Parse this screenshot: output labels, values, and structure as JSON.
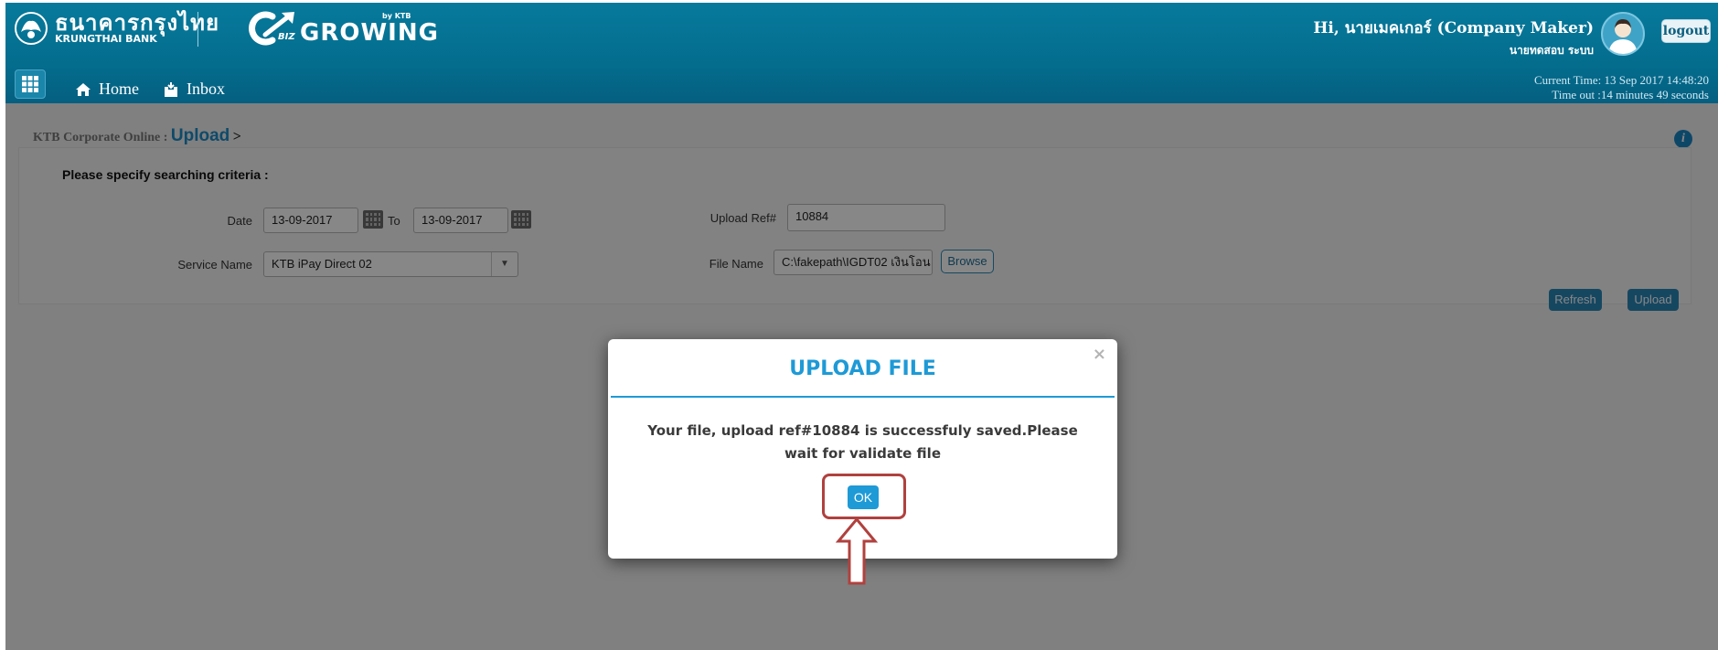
{
  "header": {
    "bank_name_th": "ธนาคารกรุงไทย",
    "bank_name_en": "KRUNGTHAI BANK",
    "product_by": "by KTB",
    "product_biz": "BIZ",
    "product_name": "GROWING",
    "greeting": "Hi, นายเมคเกอร์ (Company Maker)",
    "user_sub": "นายทดสอบ ระบบ",
    "logout_label": "logout",
    "current_time": "Current Time: 13 Sep 2017 14:48:20",
    "timeout": "Time out :14 minutes 49 seconds"
  },
  "nav": {
    "items": [
      {
        "label": "Home",
        "icon": "home-icon"
      },
      {
        "label": "Inbox",
        "icon": "inbox-icon"
      }
    ]
  },
  "breadcrumb": {
    "root": "KTB Corporate Online :",
    "current": "Upload",
    "separator": ">"
  },
  "criteria": {
    "title": "Please specify searching criteria :",
    "date_label": "Date",
    "date_from": "13-09-2017",
    "to_label": "To",
    "date_to": "13-09-2017",
    "service_label": "Service Name",
    "service_value": "KTB iPay Direct 02",
    "upload_ref_label": "Upload Ref#",
    "upload_ref_value": "10884",
    "file_name_label": "File Name",
    "file_name_value": "C:\\fakepath\\IGDT02 เงินโอน",
    "browse_label": "Browse"
  },
  "actions": {
    "refresh_label": "Refresh",
    "upload_label": "Upload"
  },
  "modal": {
    "title": "UPLOAD FILE",
    "close": "×",
    "message": "Your file, upload ref#10884 is successfuly saved.Please wait for validate file",
    "ok_label": "OK"
  },
  "colors": {
    "header": "#046d8e",
    "accent": "#1e9ad6",
    "highlight": "#b0413e"
  }
}
